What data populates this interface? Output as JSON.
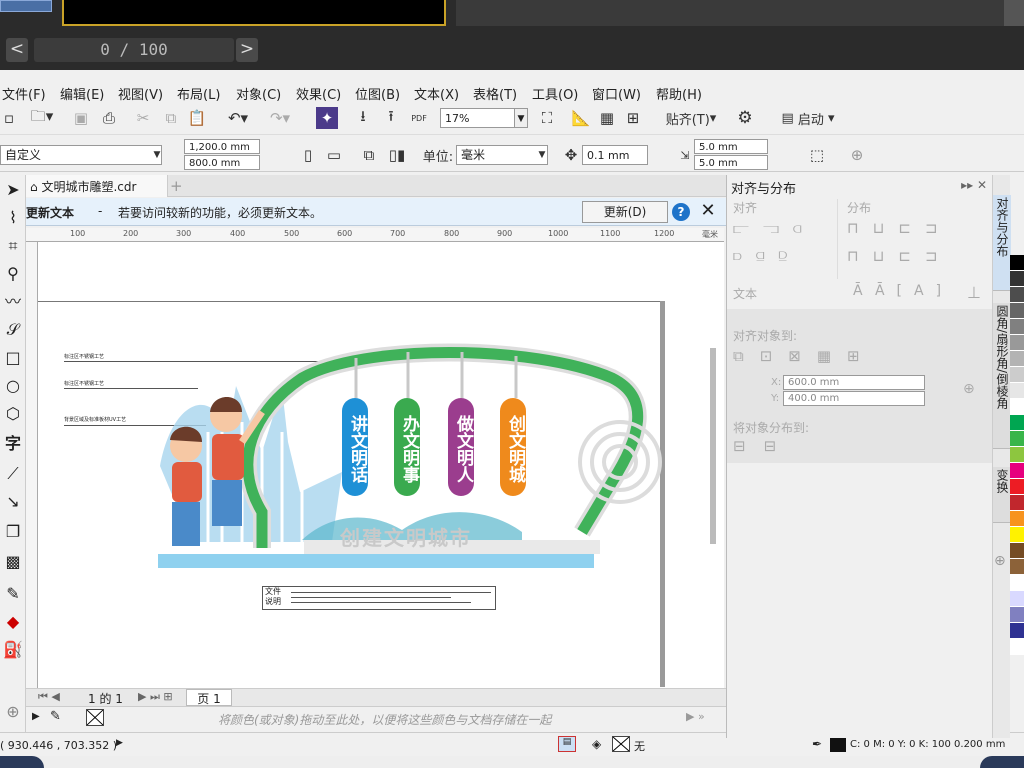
{
  "pager": {
    "prev": "<",
    "next": ">",
    "text": "0 / 100"
  },
  "menu": [
    "文件(F)",
    "编辑(E)",
    "视图(V)",
    "布局(L)",
    "对象(C)",
    "效果(C)",
    "位图(B)",
    "文本(X)",
    "表格(T)",
    "工具(O)",
    "窗口(W)",
    "帮助(H)"
  ],
  "toolbar": {
    "zoom": "17%",
    "snap": "贴齐(T)",
    "launch": "启动"
  },
  "propbar": {
    "preset": "自定义",
    "width": "1,200.0 mm",
    "height": "800.0 mm",
    "unit_label": "单位:",
    "unit": "毫米",
    "nudge": "0.1 mm",
    "dup_x": "5.0 mm",
    "dup_y": "5.0 mm"
  },
  "doc": {
    "tab": "文明城市雕塑.cdr"
  },
  "infobar": {
    "title": "更新文本",
    "dash": "-",
    "message": "若要访问较新的功能，必须更新文本。",
    "button": "更新(D)",
    "help": "?",
    "close": "✕"
  },
  "ruler": {
    "ticks": [
      "100",
      "200",
      "300",
      "400",
      "500",
      "600",
      "700",
      "800",
      "900",
      "1000",
      "1100",
      "1200"
    ],
    "unit": "毫米"
  },
  "artwork": {
    "labels": [
      "标注区不锈钢工艺",
      "标注区不锈钢工艺",
      "背景区域及标准板材UV工艺"
    ],
    "pillars": [
      {
        "text": "讲文明话",
        "color": "#1e90d6"
      },
      {
        "text": "办文明事",
        "color": "#3aaa4f"
      },
      {
        "text": "做文明人",
        "color": "#9b3d8e"
      },
      {
        "text": "创文明城",
        "color": "#ef8a1c"
      }
    ],
    "slogan": "创建文明城市",
    "note": {
      "l1": "文件",
      "l2": "说明"
    }
  },
  "pagebar": {
    "pages": "1 的 1",
    "page_tab": "页 1"
  },
  "colorwell": {
    "hint": "将颜色(或对象)拖动至此处，以便将这些颜色与文档存储在一起"
  },
  "status": {
    "coords": "( 930.446 , 703.352 )",
    "fill": "无",
    "outline": "C: 0 M: 0 Y: 0 K: 100  0.200 mm"
  },
  "panel": {
    "title": "对齐与分布",
    "align": "对齐",
    "distribute": "分布",
    "text": "文本",
    "align_to": "对齐对象到:",
    "x": "600.0 mm",
    "y": "400.0 mm",
    "distribute_to": "将对象分布到:"
  },
  "sidetabs": [
    "对齐与分布",
    "圆角/扇形角/倒棱角",
    "变换"
  ],
  "palette": [
    "#000000",
    "#333333",
    "#4d4d4d",
    "#666666",
    "#808080",
    "#999999",
    "#b3b3b3",
    "#cccccc",
    "#e6e6e6",
    "#ffffff",
    "#00a651",
    "#39b54a",
    "#8dc63f",
    "#e6007e",
    "#ed1c24",
    "#c1272d",
    "#f7931e",
    "#fff200",
    "#754c24",
    "#8c6239",
    "#ffffff",
    "#d9d9ff",
    "#8080c0",
    "#2e3192",
    "#ffffff"
  ]
}
